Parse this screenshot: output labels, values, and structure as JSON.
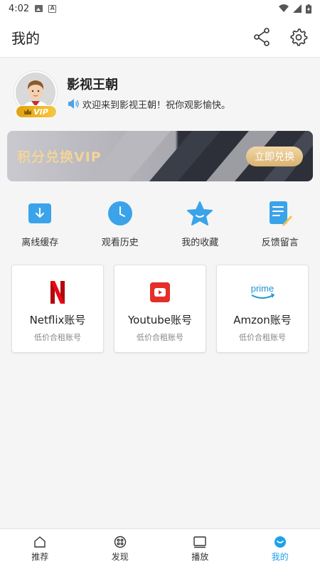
{
  "status_bar": {
    "time": "4:02",
    "font_glyph": "A"
  },
  "header": {
    "title": "我的"
  },
  "profile": {
    "name": "影视王朝",
    "welcome": "欢迎来到影视王朝！祝你观影愉快。",
    "vip_badge": "VIP"
  },
  "vip_banner": {
    "title": "积分兑换VIP",
    "button": "立即兑换"
  },
  "quick_actions": [
    {
      "label": "离线缓存",
      "icon": "download-icon"
    },
    {
      "label": "观看历史",
      "icon": "clock-icon"
    },
    {
      "label": "我的收藏",
      "icon": "star-icon"
    },
    {
      "label": "反馈留言",
      "icon": "feedback-icon"
    }
  ],
  "accounts": [
    {
      "name": "Netflix账号",
      "sub": "低价合租账号",
      "icon": "netflix-logo"
    },
    {
      "name": "Youtube账号",
      "sub": "低价合租账号",
      "icon": "youtube-logo"
    },
    {
      "name": "Amzon账号",
      "sub": "低价合租账号",
      "icon": "prime-logo",
      "logo_text": "prime"
    }
  ],
  "tabs": [
    {
      "label": "推荐",
      "icon": "home-icon"
    },
    {
      "label": "发现",
      "icon": "film-reel-icon"
    },
    {
      "label": "播放",
      "icon": "screen-icon"
    },
    {
      "label": "我的",
      "icon": "profile-icon",
      "active": true
    }
  ],
  "colors": {
    "accent": "#1ea1e8",
    "vip_gold": "#f2d49a",
    "netflix_red": "#e50914",
    "youtube_red": "#e52d27",
    "prime_blue": "#1a98d5"
  }
}
